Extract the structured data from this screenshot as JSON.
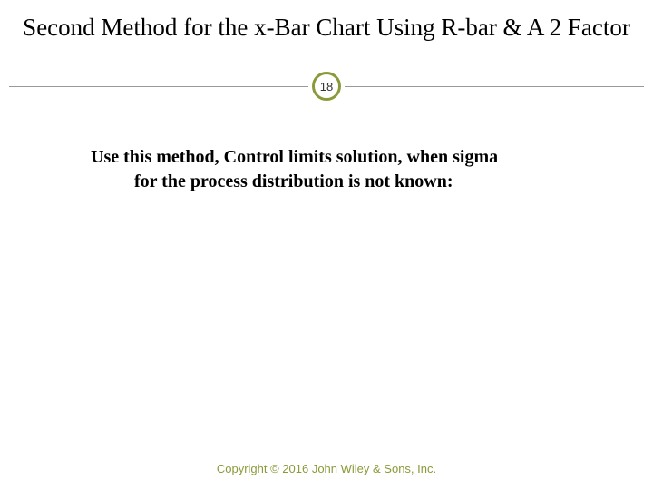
{
  "title": "Second Method for the x-Bar Chart Using R-bar & A 2 Factor",
  "slide_number": "18",
  "body_line1": "Use this method, Control limits solution, when sigma",
  "body_line2": "for the process distribution is not known:",
  "footer": "Copyright © 2016 John Wiley & Sons, Inc."
}
